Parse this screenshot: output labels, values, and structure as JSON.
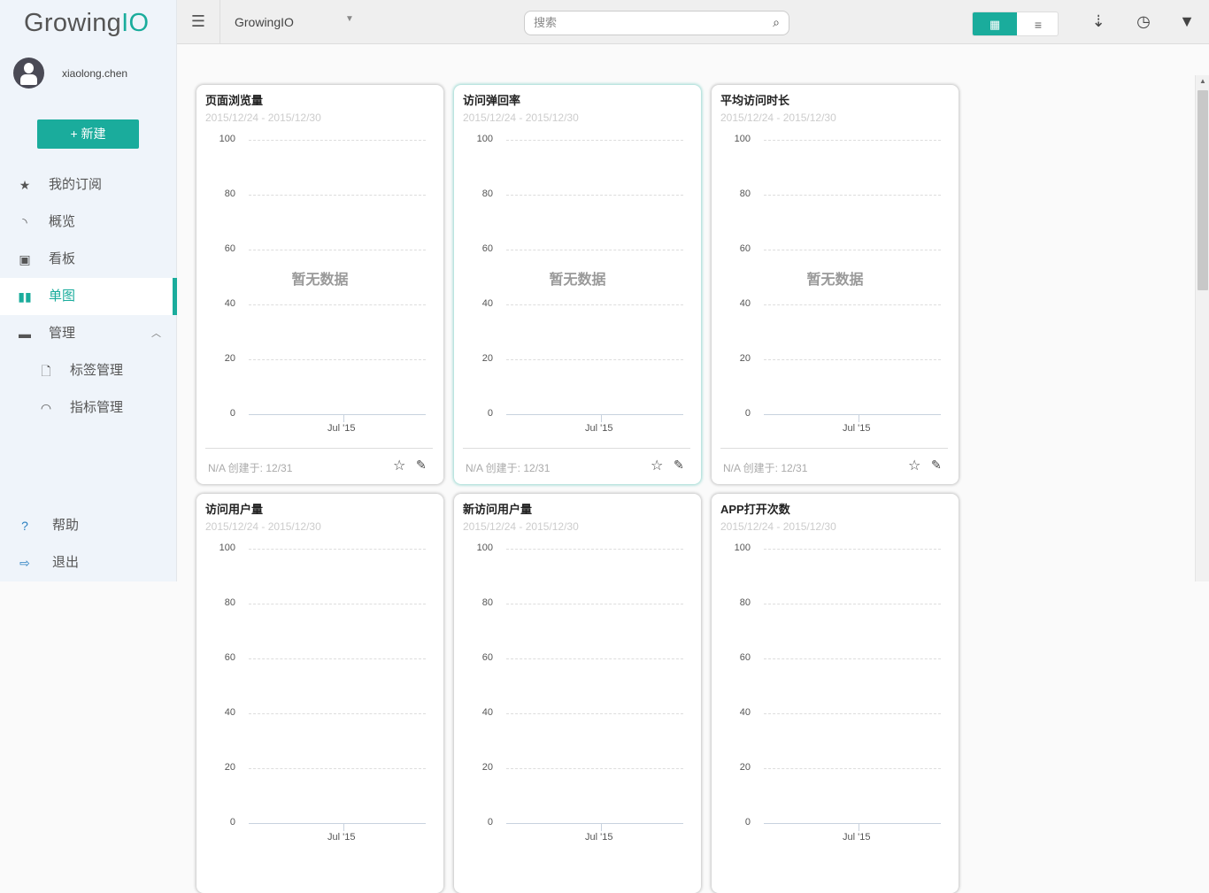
{
  "app": {
    "logo_main": "Growing",
    "logo_accent": "IO",
    "username": "xiaolong.chen",
    "new_button": "+ 新建"
  },
  "sidebar": {
    "items": [
      {
        "label": "我的订阅",
        "icon": "star-icon",
        "glyph": "★"
      },
      {
        "label": "概览",
        "icon": "rss-icon",
        "glyph": "◝"
      },
      {
        "label": "看板",
        "icon": "dashboard-icon",
        "glyph": "▣"
      },
      {
        "label": "单图",
        "icon": "bar-chart-icon",
        "glyph": "▮▮",
        "active": true
      },
      {
        "label": "管理",
        "icon": "archive-icon",
        "glyph": "▬",
        "expanded": true
      },
      {
        "label": "标签管理",
        "icon": "tag-file-icon",
        "glyph": "🗋",
        "sub": true
      },
      {
        "label": "指标管理",
        "icon": "gauge-icon",
        "glyph": "◠",
        "sub": true
      }
    ],
    "bottom": [
      {
        "label": "帮助",
        "icon": "help-icon",
        "glyph": "?"
      },
      {
        "label": "退出",
        "icon": "logout-icon",
        "glyph": "⇨"
      }
    ]
  },
  "topbar": {
    "project": "GrowingIO",
    "search_placeholder": "搜索"
  },
  "colors": {
    "accent": "#1aac9c"
  },
  "cards": [
    {
      "title": "页面浏览量",
      "date": "2015/12/24 - 2015/12/30",
      "empty": "暂无数据",
      "footer": "N/A 创建于: 12/31"
    },
    {
      "title": "访问弹回率",
      "date": "2015/12/24 - 2015/12/30",
      "empty": "暂无数据",
      "footer": "N/A 创建于: 12/31",
      "highlighted": true
    },
    {
      "title": "平均访问时长",
      "date": "2015/12/24 - 2015/12/30",
      "empty": "暂无数据",
      "footer": "N/A 创建于: 12/31"
    },
    {
      "title": "访问用户量",
      "date": "2015/12/24 - 2015/12/30"
    },
    {
      "title": "新访问用户量",
      "date": "2015/12/24 - 2015/12/30"
    },
    {
      "title": "APP打开次数",
      "date": "2015/12/24 - 2015/12/30"
    }
  ],
  "chart_axis": {
    "y_ticks": [
      "100",
      "80",
      "60",
      "40",
      "20",
      "0"
    ],
    "x_ticks": [
      "Jul '15"
    ]
  }
}
